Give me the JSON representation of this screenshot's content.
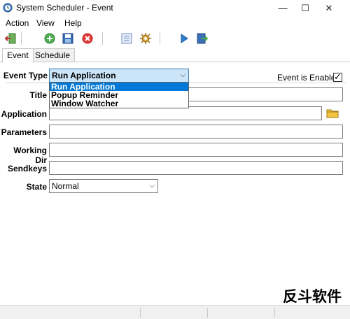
{
  "window": {
    "title": "System Scheduler - Event",
    "minimize": "—",
    "maximize": "☐",
    "close": "✕"
  },
  "menu": {
    "items": [
      {
        "label": "Action"
      },
      {
        "label": "View"
      },
      {
        "label": "Help"
      }
    ]
  },
  "toolbar": {
    "icons": [
      {
        "name": "exit-icon"
      },
      {
        "name": "add-icon"
      },
      {
        "name": "save-icon"
      },
      {
        "name": "delete-icon"
      },
      {
        "name": "list-icon"
      },
      {
        "name": "settings-icon"
      },
      {
        "name": "run-icon"
      },
      {
        "name": "export-icon"
      }
    ]
  },
  "tabs": [
    {
      "label": "Event"
    },
    {
      "label": "Schedule"
    }
  ],
  "form": {
    "event_type": {
      "label": "Event Type",
      "value": "Run Application",
      "options": [
        "Run Application",
        "Popup Reminder",
        "Window Watcher"
      ]
    },
    "enabled": {
      "label": "Event is Enabled",
      "checked": "✓"
    },
    "title": {
      "label": "Title",
      "value": ""
    },
    "application": {
      "label": "Application",
      "value": ""
    },
    "parameters": {
      "label": "Parameters",
      "value": ""
    },
    "working_dir": {
      "label": "Working Dir",
      "value": ""
    },
    "sendkeys": {
      "label": "Sendkeys",
      "value": ""
    },
    "state": {
      "label": "State",
      "value": "Normal"
    }
  },
  "watermark": "反斗软件",
  "colors": {
    "accent": "#0078d7",
    "focus_bg": "#cce4f7"
  }
}
